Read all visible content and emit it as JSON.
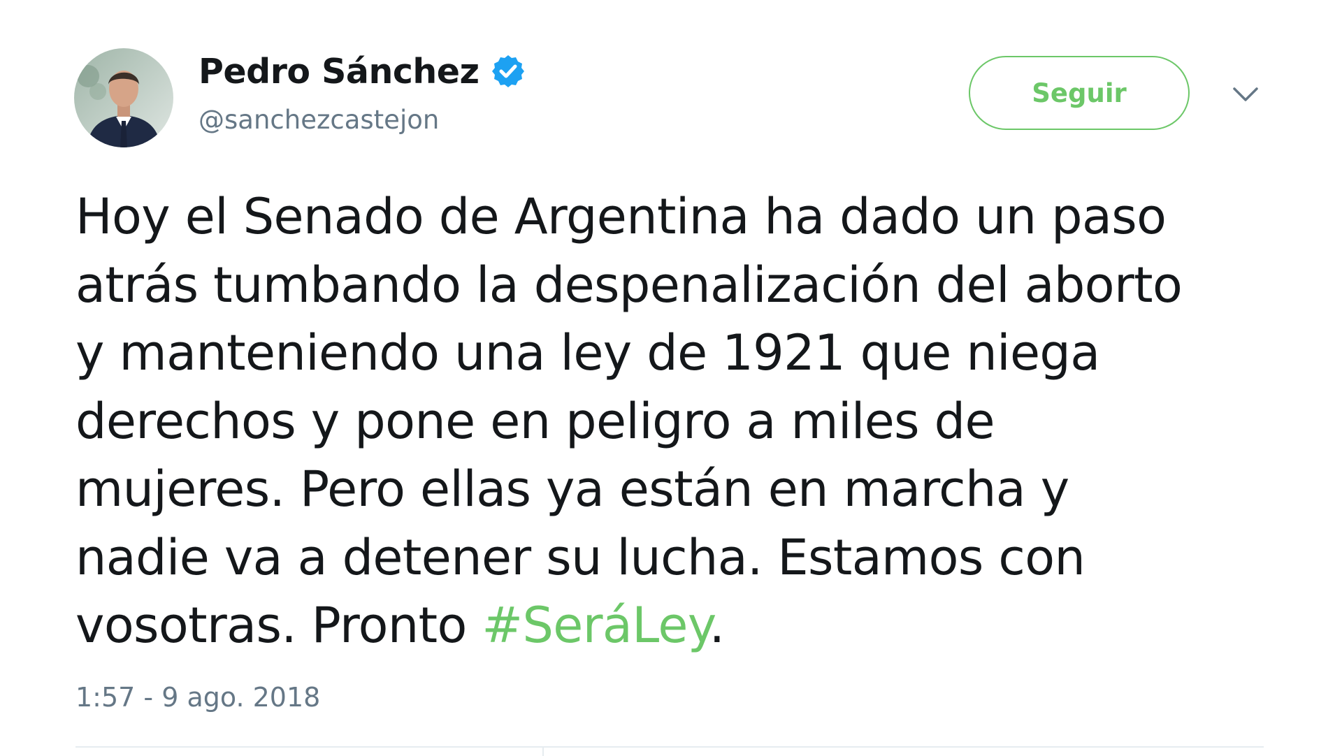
{
  "author": {
    "display_name": "Pedro Sánchez",
    "handle": "@sanchezcastejon",
    "verified": true,
    "avatar_icon": "profile-photo"
  },
  "actions": {
    "follow_label": "Seguir",
    "more_icon": "chevron-down-icon"
  },
  "tweet": {
    "lines": [
      "Hoy el Senado de Argentina ha dado un paso",
      "atrás tumbando la despenalización del aborto",
      "y manteniendo una ley de 1921 que niega",
      "derechos y pone en peligro a miles de",
      "mujeres. Pero ellas ya están en marcha y",
      "nadie va a detener su lucha. Estamos con"
    ],
    "last_line_text": "vosotras. Pronto ",
    "hashtag": "#SeráLey",
    "last_line_end": ".",
    "timestamp": "1:57 - 9 ago. 2018"
  },
  "colors": {
    "accent": "#6cc768",
    "verified_badge": "#1da1f2",
    "text_primary": "#14171a",
    "text_secondary": "#657786",
    "divider": "#e6ecf0"
  }
}
